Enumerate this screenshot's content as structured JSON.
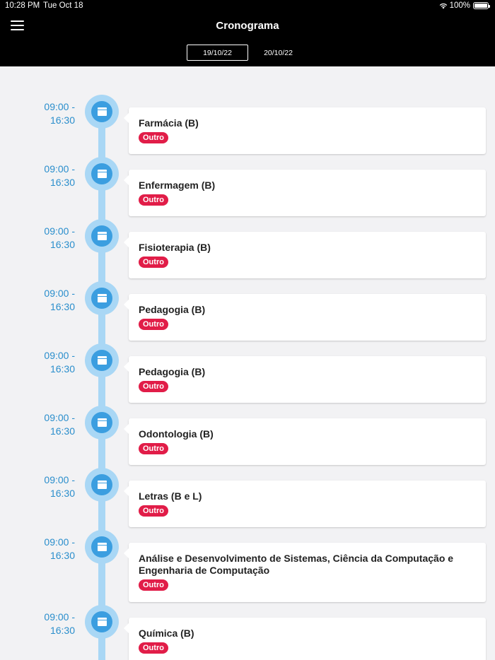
{
  "status": {
    "time": "10:28 PM",
    "date": "Tue Oct 18",
    "battery": "100%"
  },
  "header": {
    "title": "Cronograma"
  },
  "tabs": [
    {
      "label": "19/10/22",
      "active": true
    },
    {
      "label": "20/10/22",
      "active": false
    }
  ],
  "events": [
    {
      "time_start": "09:00 -",
      "time_end": "16:30",
      "title": "Farmácia (B)",
      "tag": "Outro"
    },
    {
      "time_start": "09:00 -",
      "time_end": "16:30",
      "title": "Enfermagem (B)",
      "tag": "Outro"
    },
    {
      "time_start": "09:00 -",
      "time_end": "16:30",
      "title": "Fisioterapia (B)",
      "tag": "Outro"
    },
    {
      "time_start": "09:00 -",
      "time_end": "16:30",
      "title": "Pedagogia (B)",
      "tag": "Outro"
    },
    {
      "time_start": "09:00 -",
      "time_end": "16:30",
      "title": "Pedagogia (B)",
      "tag": "Outro"
    },
    {
      "time_start": "09:00 -",
      "time_end": "16:30",
      "title": "Odontologia (B)",
      "tag": "Outro"
    },
    {
      "time_start": "09:00 -",
      "time_end": "16:30",
      "title": "Letras (B e L)",
      "tag": "Outro"
    },
    {
      "time_start": "09:00 -",
      "time_end": "16:30",
      "title": "Análise e Desenvolvimento de Sistemas, Ciência da Computação e Engenharia de Computação",
      "tag": "Outro"
    },
    {
      "time_start": "09:00 -",
      "time_end": "16:30",
      "title": "Química (B)",
      "tag": "Outro"
    }
  ]
}
